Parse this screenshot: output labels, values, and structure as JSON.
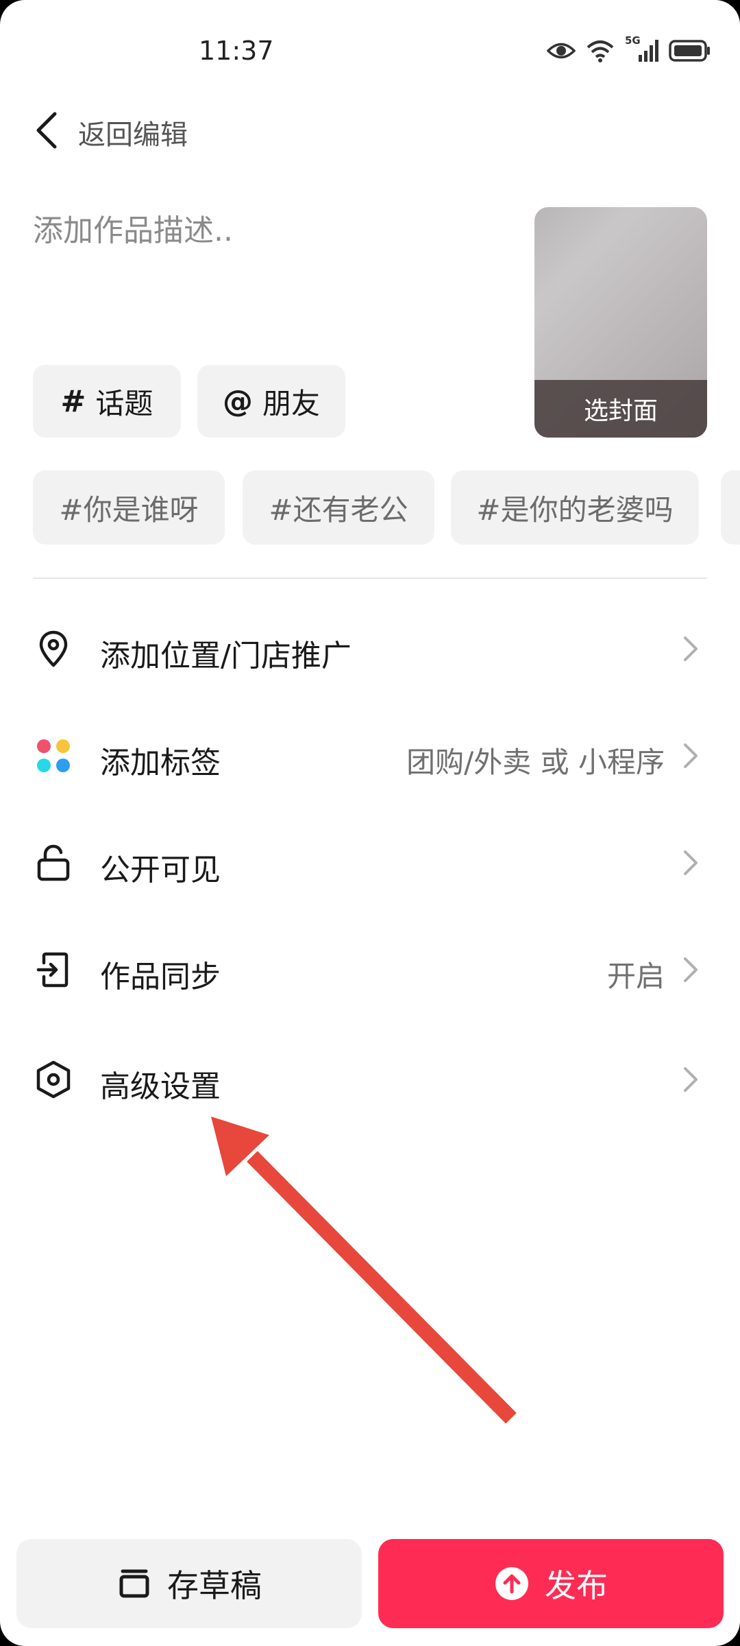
{
  "status_bar": {
    "time": "11:37",
    "network": "5G"
  },
  "header": {
    "back_label": "返回编辑"
  },
  "description": {
    "placeholder": "添加作品描述.."
  },
  "chips": [
    {
      "symbol": "#",
      "label": "话题"
    },
    {
      "symbol": "@",
      "label": "朋友"
    }
  ],
  "cover": {
    "label": "选封面"
  },
  "hashtag_suggestions": [
    "#你是谁呀",
    "#还有老公",
    "#是你的老婆吗"
  ],
  "menu": [
    {
      "icon": "location-pin-icon",
      "label": "添加位置/门店推广",
      "value": ""
    },
    {
      "icon": "colorful-dots-icon",
      "label": "添加标签",
      "value": "团购/外卖 或 小程序"
    },
    {
      "icon": "unlock-icon",
      "label": "公开可见",
      "value": ""
    },
    {
      "icon": "sync-icon",
      "label": "作品同步",
      "value": "开启"
    },
    {
      "icon": "hexagon-gear-icon",
      "label": "高级设置",
      "value": ""
    }
  ],
  "buttons": {
    "draft_label": "存草稿",
    "publish_label": "发布"
  },
  "colors": {
    "accent": "#fe2c55",
    "annotation_arrow": "#e8473b",
    "chip_bg": "#f2f2f2"
  }
}
